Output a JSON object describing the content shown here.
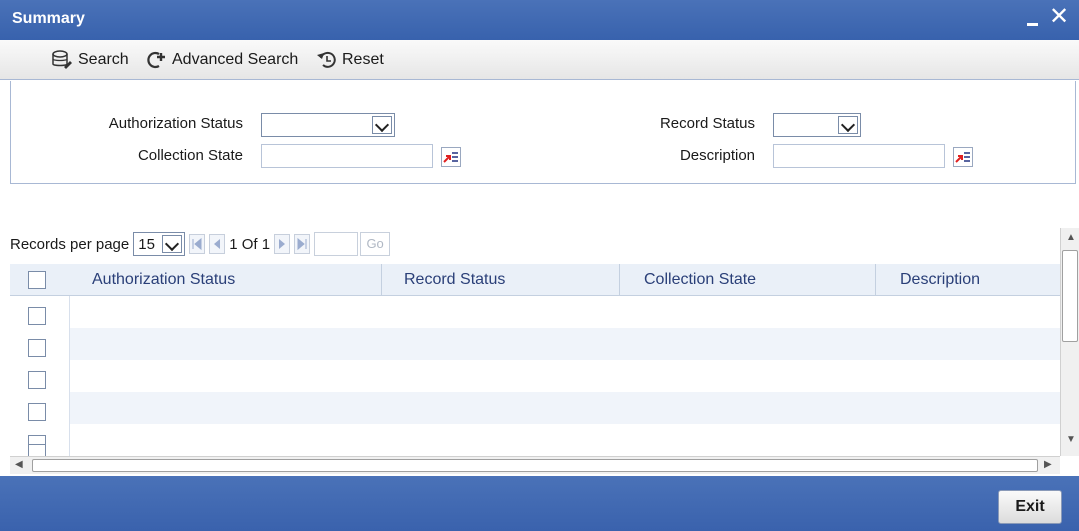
{
  "window": {
    "title": "Summary"
  },
  "toolbar": {
    "search": "Search",
    "advanced_search": "Advanced Search",
    "reset": "Reset"
  },
  "criteria": {
    "authorization_status_label": "Authorization Status",
    "collection_state_label": "Collection State",
    "record_status_label": "Record Status",
    "description_label": "Description"
  },
  "pager": {
    "records_per_page_label": "Records per page",
    "records_per_page_value": "15",
    "page_info": "1 Of 1",
    "go_label": "Go"
  },
  "grid": {
    "columns": [
      "Authorization Status",
      "Record Status",
      "Collection State",
      "Description"
    ],
    "empty_rows": 6
  },
  "footer": {
    "exit_label": "Exit"
  },
  "colors": {
    "header_blue": "#3862ad",
    "column_text": "#2a3f78"
  }
}
